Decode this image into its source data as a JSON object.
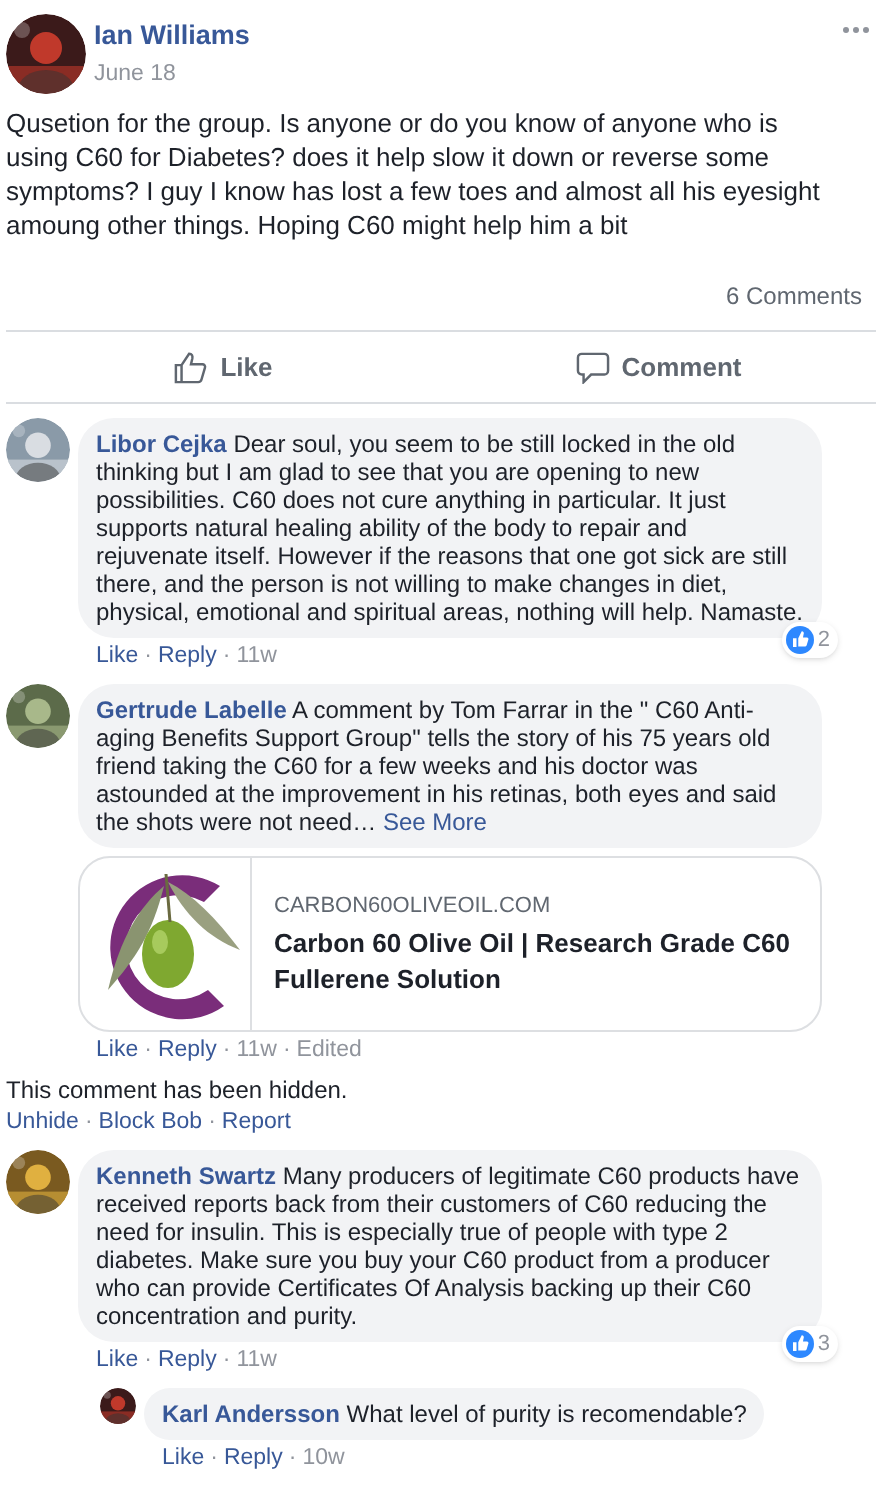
{
  "post": {
    "author": "Ian Williams",
    "date": "June 18",
    "text": "Qusetion for the group. Is anyone or do you know of anyone who is using C60 for Diabetes? does it help slow it down or reverse some symptoms? I guy I know has lost a few toes and almost all his eyesight amoung other things. Hoping C60 might help him a bit",
    "comment_count": "6 Comments",
    "actions": [
      "Like",
      "Comment"
    ]
  },
  "separator": "·",
  "comments": [
    {
      "kind": "comment",
      "author": "Libor Cejka",
      "text": "Dear soul, you seem to be still locked in the old thinking but I am glad to see that you are opening to new possibilities. C60 does not cure anything in particular. It just supports natural healing ability of the body to repair and rejuvenate itself. However if the reasons that one got sick are still there, and the person is not willing to make changes in diet, physical, emotional and spiritual areas, nothing will help. Namaste.",
      "reactions": "2",
      "actions": [
        "Like",
        "Reply"
      ],
      "time": "11w"
    },
    {
      "kind": "comment",
      "author": "Gertrude Labelle",
      "text": "A comment by Tom Farrar in the \" C60 Anti-aging Benefits Support Group\" tells the story of his 75 years old friend taking the C60 for a few weeks and his doctor was astounded at the improvement in his retinas, both eyes and said the shots were not need…",
      "see_more": "See More",
      "link": {
        "domain": "CARBON60OLIVEOIL.COM",
        "title": "Carbon 60 Olive Oil | Research Grade C60 Fullerene Solution"
      },
      "actions": [
        "Like",
        "Reply"
      ],
      "time": "11w",
      "edited": "Edited"
    },
    {
      "kind": "hidden",
      "text": "This comment has been hidden.",
      "actions": [
        "Unhide",
        "Block Bob",
        "Report"
      ]
    },
    {
      "kind": "comment",
      "author": "Kenneth Swartz",
      "text": "Many producers of legitimate C60 products have received reports back from their customers of C60 reducing the need for insulin. This is especially true of people with type 2 diabetes. Make sure you buy your C60 product from a producer who can provide Certificates Of Analysis backing up their C60 concentration and purity.",
      "reactions": "3",
      "actions": [
        "Like",
        "Reply"
      ],
      "time": "11w",
      "children": [
        {
          "kind": "comment",
          "author": "Karl Andersson",
          "text": "What level of purity is recomendable?",
          "actions": [
            "Like",
            "Reply"
          ],
          "time": "10w"
        }
      ]
    }
  ]
}
